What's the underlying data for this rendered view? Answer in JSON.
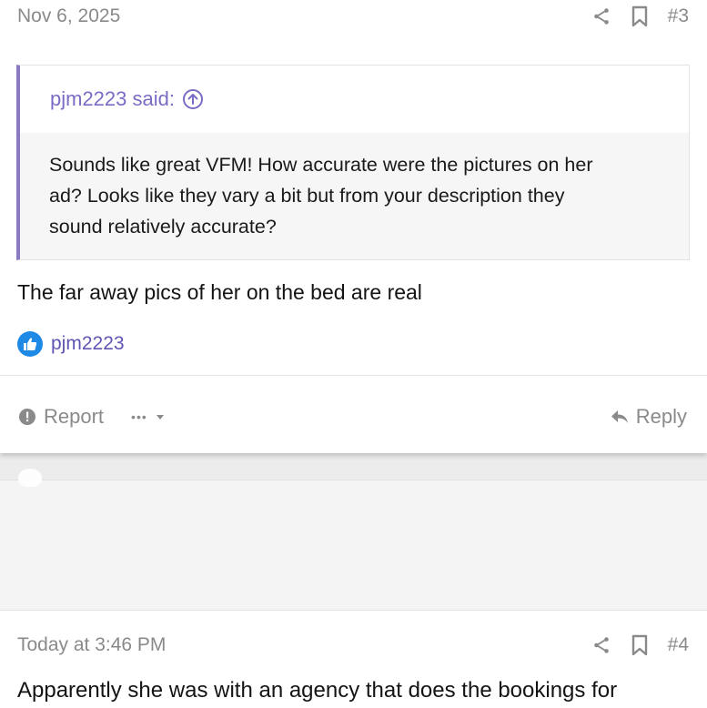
{
  "post3": {
    "date": "Nov 6, 2025",
    "number": "#3",
    "quote": {
      "author_said": "pjm2223 said:",
      "lines": [
        "Sounds like great VFM! How accurate were the pictures on her",
        "ad? Looks like they vary a bit but from your description they",
        "sound relatively accurate?"
      ]
    },
    "message": "The far away pics of her on the bed are real",
    "reaction_user": "pjm2223",
    "actions": {
      "report": "Report",
      "more": "•••",
      "reply": "Reply"
    }
  },
  "post4": {
    "date": "Today at 3:46 PM",
    "number": "#4",
    "message": "Apparently she was with an agency that does the bookings for"
  },
  "colors": {
    "accent": "#7a6cc4",
    "like": "#1f8ae6",
    "muted": "#8a8a8a"
  }
}
